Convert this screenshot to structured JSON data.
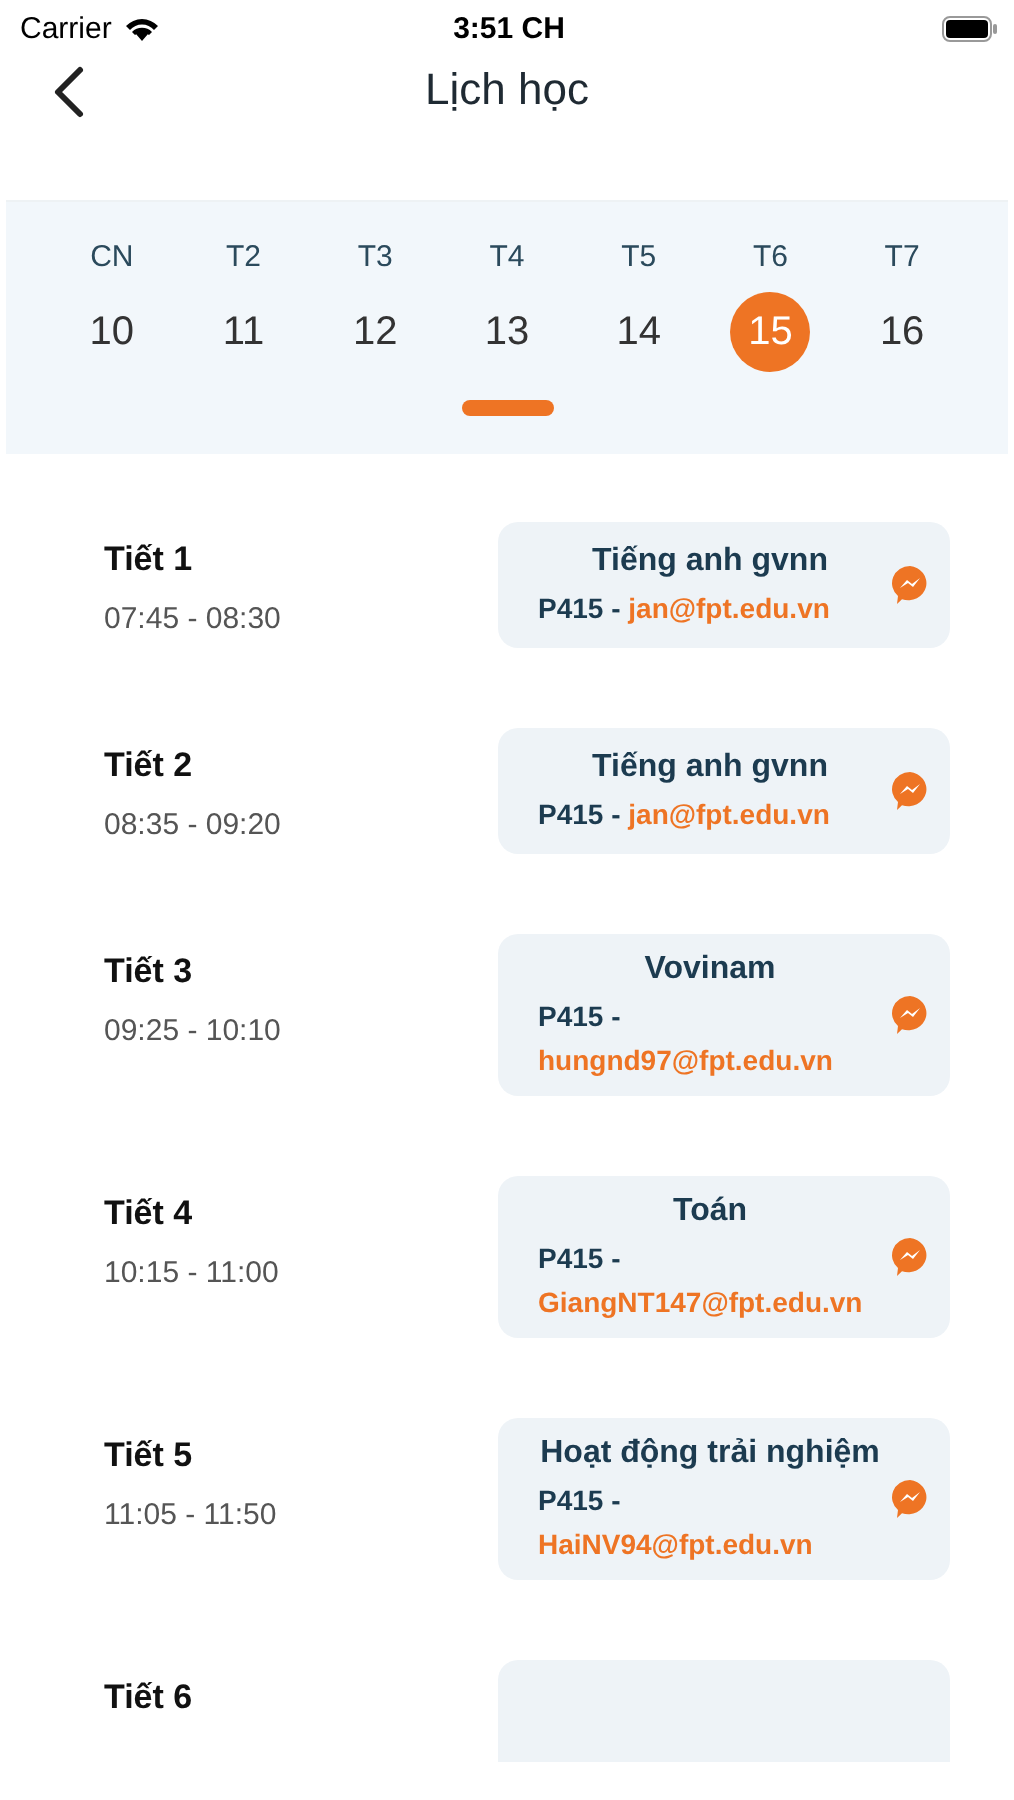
{
  "status_bar": {
    "carrier": "Carrier",
    "time": "3:51 CH"
  },
  "nav": {
    "title": "Lịch học"
  },
  "week": [
    {
      "weekday": "CN",
      "date": "10",
      "selected": false
    },
    {
      "weekday": "T2",
      "date": "11",
      "selected": false
    },
    {
      "weekday": "T3",
      "date": "12",
      "selected": false
    },
    {
      "weekday": "T4",
      "date": "13",
      "selected": false
    },
    {
      "weekday": "T5",
      "date": "14",
      "selected": false
    },
    {
      "weekday": "T6",
      "date": "15",
      "selected": true
    },
    {
      "weekday": "T7",
      "date": "16",
      "selected": false
    }
  ],
  "schedule": [
    {
      "period": "Tiết 1",
      "time": "07:45 - 08:30",
      "subject": "Tiếng anh gvnn",
      "room": "P415 -",
      "email": "jan@fpt.edu.vn"
    },
    {
      "period": "Tiết 2",
      "time": "08:35 - 09:20",
      "subject": "Tiếng anh gvnn",
      "room": "P415 -",
      "email": "jan@fpt.edu.vn"
    },
    {
      "period": "Tiết 3",
      "time": "09:25 - 10:10",
      "subject": "Vovinam",
      "room": "P415 -",
      "email": "hungnd97@fpt.edu.vn"
    },
    {
      "period": "Tiết 4",
      "time": "10:15 - 11:00",
      "subject": "Toán",
      "room": "P415 -",
      "email": "GiangNT147@fpt.edu.vn"
    },
    {
      "period": "Tiết 5",
      "time": "11:05 - 11:50",
      "subject": "Hoạt động trải nghiệm",
      "room": "P415 -",
      "email": "HaiNV94@fpt.edu.vn"
    },
    {
      "period": "Tiết 6"
    }
  ]
}
